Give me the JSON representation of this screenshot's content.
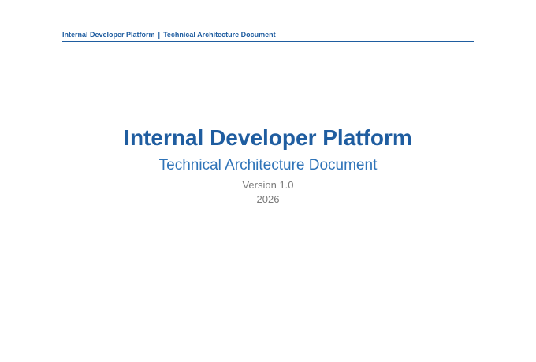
{
  "header": {
    "left": "Internal Developer Platform",
    "separator": "|",
    "right": "Technical Architecture Document"
  },
  "cover": {
    "title": "Internal Developer Platform",
    "subtitle": "Technical Architecture Document",
    "version": "Version 1.0",
    "year": "2026"
  },
  "colors": {
    "primary": "#1f5da0",
    "secondary": "#2e73b8",
    "muted": "#7a7a7a"
  }
}
